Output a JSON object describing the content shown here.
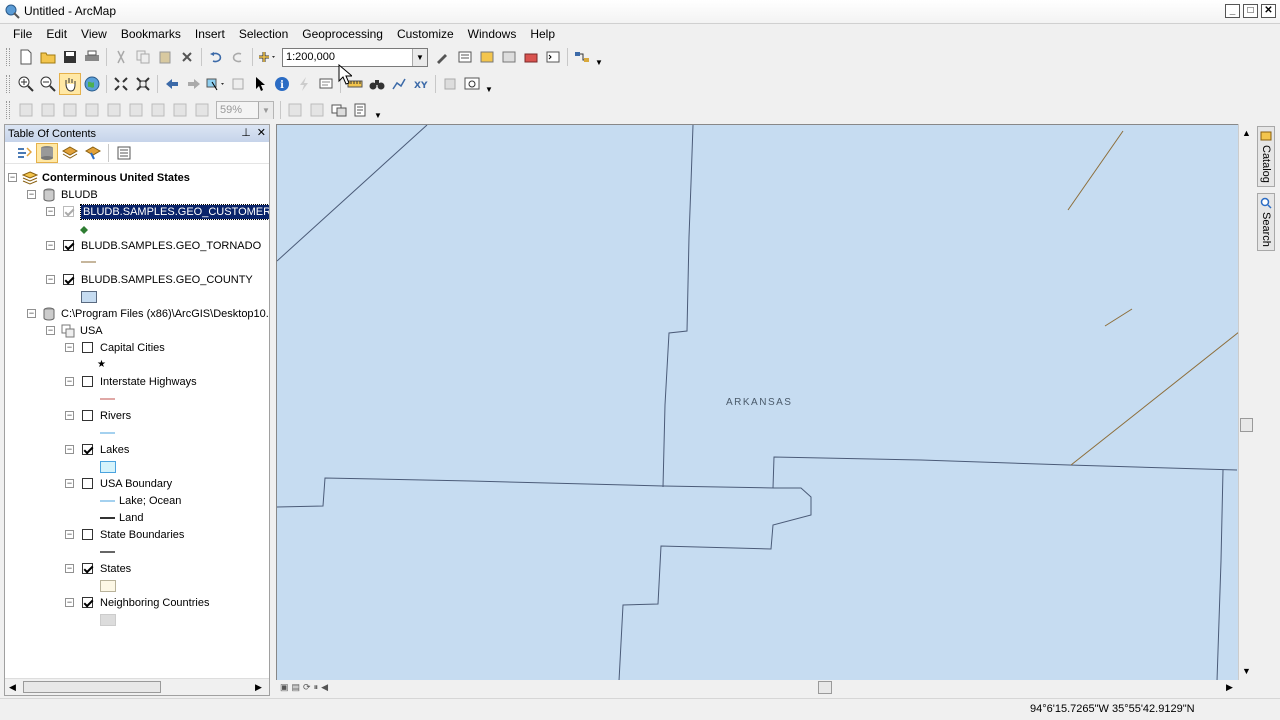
{
  "window": {
    "title": "Untitled - ArcMap"
  },
  "menu": [
    "File",
    "Edit",
    "View",
    "Bookmarks",
    "Insert",
    "Selection",
    "Geoprocessing",
    "Customize",
    "Windows",
    "Help"
  ],
  "toolbar": {
    "scale": "1:200,000",
    "zoom_percent": "59%"
  },
  "toc": {
    "title": "Table Of Contents",
    "root": "Conterminous United States",
    "db_group": "BLUDB",
    "db_layers": [
      "BLUDB.SAMPLES.GEO_CUSTOMER",
      "BLUDB.SAMPLES.GEO_TORNADO",
      "BLUDB.SAMPLES.GEO_COUNTY"
    ],
    "file_group": "C:\\Program Files (x86)\\ArcGIS\\Desktop10.:",
    "usa_group": "USA",
    "usa_layers": {
      "capital_cities": "Capital Cities",
      "interstate_highways": "Interstate Highways",
      "rivers": "Rivers",
      "lakes": "Lakes",
      "usa_boundary": "USA Boundary",
      "lake_ocean": "Lake; Ocean",
      "land": "Land",
      "state_boundaries": "State Boundaries",
      "states": "States",
      "neighboring_countries": "Neighboring Countries"
    }
  },
  "map": {
    "label": "ARKANSAS",
    "fill": "#c6dcf1",
    "line": "#4b5b78"
  },
  "side_tabs": [
    "Catalog",
    "Search"
  ],
  "status": {
    "coords": "94°6'15.7265\"W  35°55'42.9129\"N"
  }
}
